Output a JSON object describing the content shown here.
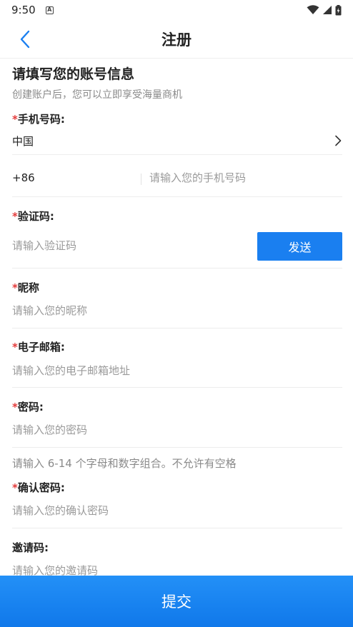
{
  "status_bar": {
    "time": "9:50",
    "app_icon_letter": "A",
    "icons": [
      "wifi-icon",
      "signal-icon",
      "battery-icon"
    ]
  },
  "header": {
    "title": "注册",
    "back_icon": "chevron-left-icon"
  },
  "intro": {
    "title": "请填写您的账号信息",
    "subtitle": "创建账户后，您可以立即享受海量商机"
  },
  "fields": {
    "phone": {
      "required_mark": "*",
      "label": "手机号码:",
      "country": "中国",
      "country_code": "+86",
      "placeholder": "请输入您的手机号码"
    },
    "code": {
      "required_mark": "*",
      "label": "验证码:",
      "placeholder": "请输入验证码",
      "send_label": "发送"
    },
    "nickname": {
      "required_mark": "*",
      "label": "昵称",
      "placeholder": "请输入您的昵称"
    },
    "email": {
      "required_mark": "*",
      "label": "电子邮箱:",
      "placeholder": "请输入您的电子邮箱地址"
    },
    "password": {
      "required_mark": "*",
      "label": "密码:",
      "placeholder": "请输入您的密码",
      "hint": "请输入 6-14 个字母和数字组合。不允许有空格"
    },
    "confirm_password": {
      "required_mark": "*",
      "label": "确认密码:",
      "placeholder": "请输入您的确认密码"
    },
    "invite": {
      "label": "邀请码:",
      "placeholder": "请输入您的邀请码"
    }
  },
  "submit": {
    "label": "提交"
  },
  "colors": {
    "primary": "#1a7ff0",
    "required": "#e33b3b",
    "placeholder": "#9a9a9a",
    "divider": "#ededed"
  }
}
